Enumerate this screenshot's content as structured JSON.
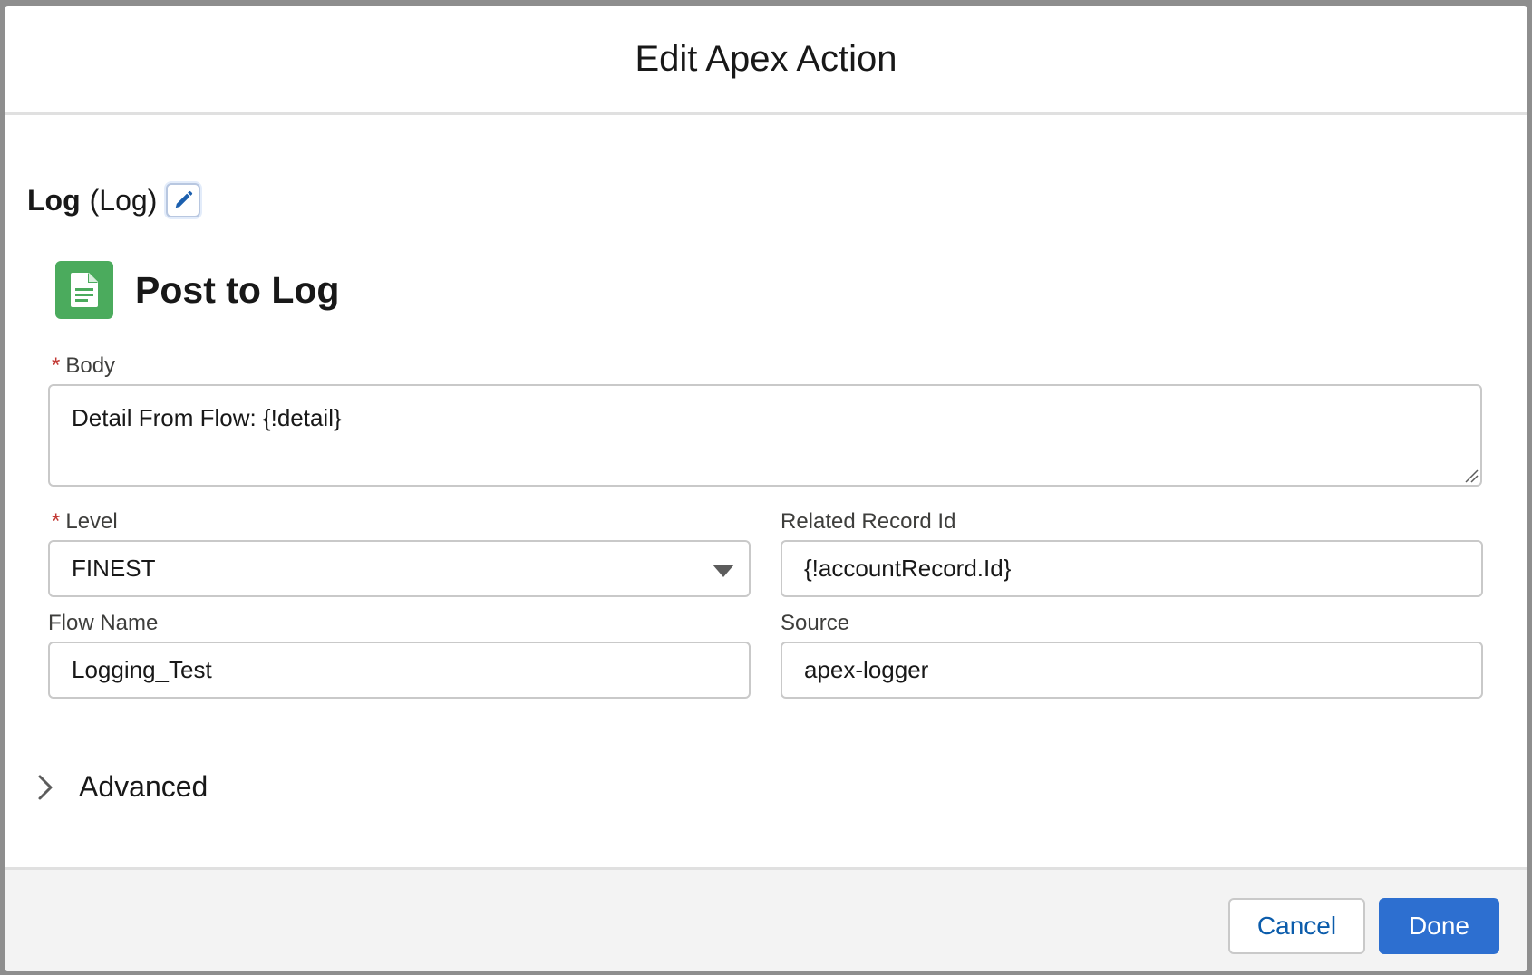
{
  "modal": {
    "title": "Edit Apex Action"
  },
  "action": {
    "name": "Log",
    "api_name": "(Log)",
    "edit_icon": "pencil-icon"
  },
  "section": {
    "icon": "document-icon",
    "icon_color": "#4bab5d",
    "title": "Post to Log"
  },
  "fields": {
    "body": {
      "label": "Body",
      "required_marker": "*",
      "value": "Detail From Flow: {!detail}"
    },
    "level": {
      "label": "Level",
      "required_marker": "*",
      "value": "FINEST"
    },
    "related_record_id": {
      "label": "Related Record Id",
      "value": "{!accountRecord.Id}"
    },
    "flow_name": {
      "label": "Flow Name",
      "value": "Logging_Test"
    },
    "source": {
      "label": "Source",
      "value": "apex-logger"
    }
  },
  "advanced": {
    "label": "Advanced",
    "icon": "chevron-right-icon"
  },
  "footer": {
    "cancel_label": "Cancel",
    "done_label": "Done",
    "brand_color": "#2d6fd0"
  }
}
